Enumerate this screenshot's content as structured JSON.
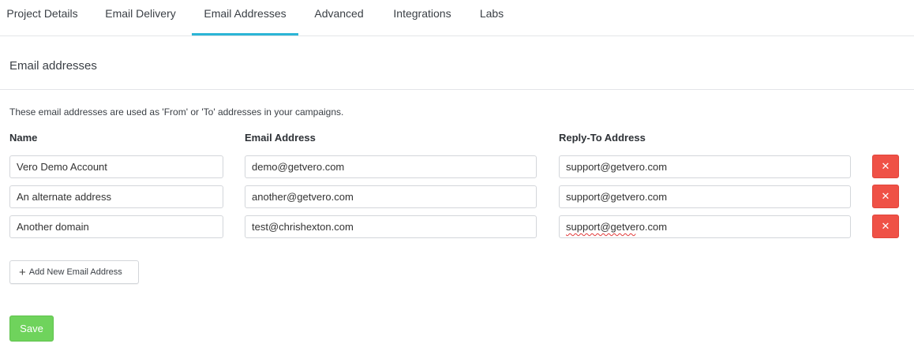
{
  "tabs": [
    "Project Details",
    "Email Delivery",
    "Email Addresses",
    "Advanced",
    "Integrations",
    "Labs"
  ],
  "active_tab": "Email Addresses",
  "section": {
    "title": "Email addresses",
    "description": "These email addresses are used as 'From' or 'To' addresses in your campaigns."
  },
  "columns": {
    "name": "Name",
    "email": "Email Address",
    "reply_to": "Reply-To Address"
  },
  "rows": [
    {
      "name": "Vero Demo Account",
      "email": "demo@getvero.com",
      "reply_to": "support@getvero.com"
    },
    {
      "name": "An alternate address",
      "email": "another@getvero.com",
      "reply_to": "support@getvero.com"
    },
    {
      "name": "Another domain",
      "email": "test@chrishexton.com",
      "reply_to_part1": "support@getve",
      "reply_to_part2": "ro.com"
    }
  ],
  "delete_glyph": "✕",
  "add_button": {
    "icon": "+",
    "label": "Add New Email Address"
  },
  "save_button": {
    "label": "Save"
  },
  "colors": {
    "accent": "#2bb5d6",
    "delete": "#ef5146",
    "save": "#6fd35c"
  }
}
